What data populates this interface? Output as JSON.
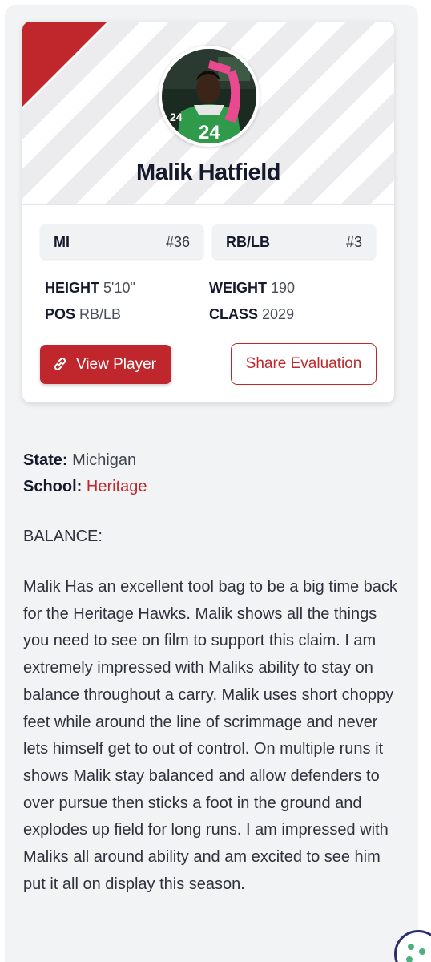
{
  "player": {
    "name": "Malik Hatfield",
    "jersey_on_photo": "24",
    "state_code": "MI",
    "state_rank": "#36",
    "position_label": "RB/LB",
    "position_rank": "#3"
  },
  "stats": {
    "height_label": "HEIGHT",
    "height_value": "5'10\"",
    "weight_label": "WEIGHT",
    "weight_value": "190",
    "pos_label": "POS",
    "pos_value": "RB/LB",
    "class_label": "CLASS",
    "class_value": "2029"
  },
  "actions": {
    "view_label": "View Player",
    "share_label": "Share Evaluation"
  },
  "details": {
    "state_label": "State:",
    "state_value": "Michigan",
    "school_label": "School:",
    "school_value": "Heritage"
  },
  "evaluation": {
    "heading": "BALANCE:",
    "text": "Malik Has an excellent tool bag to be a big time back for the Heritage Hawks. Malik shows all the things you need to see on film to support this claim. I am extremely impressed with Maliks ability to stay on balance throughout a carry. Malik uses short choppy feet while around the line of scrimmage and never lets himself get to out of control. On multiple runs it shows Malik stay balanced and allow defenders to over pursue then sticks a foot in the ground and explodes up field for long runs. I am impressed with Maliks all around ability and am excited to see him put it all on display this season."
  },
  "colors": {
    "accent": "#c0272d",
    "jersey": "#2f9a4a",
    "panel": "#f2f3f5"
  },
  "icons": {
    "view_button_icon": "link-icon",
    "floating_button_icon": "cookie-icon"
  }
}
